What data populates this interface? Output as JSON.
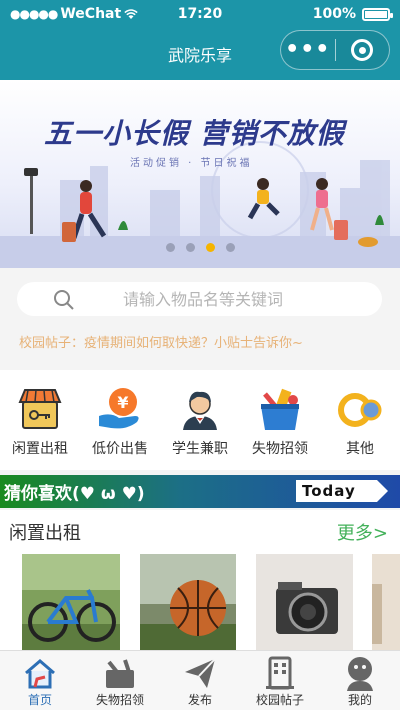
{
  "status_bar": {
    "signal": "●●●●●",
    "carrier": "WeChat",
    "time": "17:20",
    "battery": "100%",
    "battery_level": 1.0
  },
  "nav": {
    "title": "武院乐享",
    "more_label": "•••"
  },
  "banner": {
    "headline": "五一小长假  营销不放假",
    "subtitle": "活动促销 · 节日祝福",
    "slide_count": 4,
    "active_slide": 3
  },
  "search": {
    "placeholder": "请输入物品名等关键词"
  },
  "notice": {
    "text": "校园帖子：疫情期间如何取快递？小贴士告诉你~"
  },
  "categories": [
    {
      "label": "闲置出租",
      "icon": "shop-icon"
    },
    {
      "label": "低价出售",
      "icon": "yuan-hand-icon"
    },
    {
      "label": "学生兼职",
      "icon": "waiter-icon"
    },
    {
      "label": "失物招领",
      "icon": "basket-icon"
    },
    {
      "label": "其他",
      "icon": "rings-icon"
    }
  ],
  "strip": {
    "guess": "猜你喜欢(♥ ω ♥)",
    "today": "Today"
  },
  "section": {
    "title": "闲置出租",
    "more": "更多>"
  },
  "tabbar": [
    {
      "label": "首页",
      "icon": "home-icon",
      "active": true
    },
    {
      "label": "失物招领",
      "icon": "toolbox-icon",
      "active": false
    },
    {
      "label": "发布",
      "icon": "paper-plane-icon",
      "active": false
    },
    {
      "label": "校园帖子",
      "icon": "building-icon",
      "active": false
    },
    {
      "label": "我的",
      "icon": "user-icon",
      "active": false
    }
  ],
  "colors": {
    "header": "#1c95a8",
    "accent_green": "#43b15a",
    "notice": "#e7b277",
    "tab_active": "#2d6fb5",
    "dot_active": "#f5b400"
  }
}
